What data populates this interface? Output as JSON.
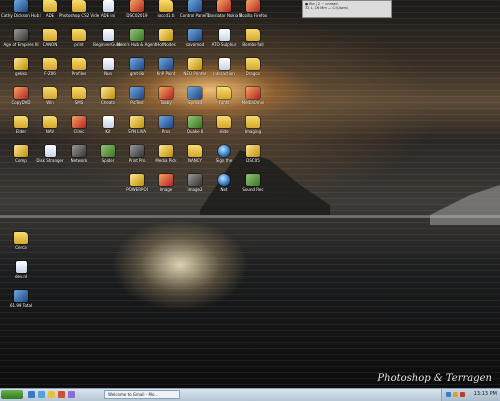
{
  "desktop": {
    "icons": [
      {
        "label": "Cathy Dickson Hub Manager",
        "kind": "app"
      },
      {
        "label": "ADE",
        "kind": "folder"
      },
      {
        "label": "Photoshop CS2 Video",
        "kind": "folder"
      },
      {
        "label": "ADE ini",
        "kind": "doc"
      },
      {
        "label": "DSC02019",
        "kind": "red"
      },
      {
        "label": "ioccd1.ti",
        "kind": "folder"
      },
      {
        "label": "Control Panel 1",
        "kind": "app"
      },
      {
        "label": "Translator Nokia 5",
        "kind": "red"
      },
      {
        "label": "Mozilla Firefox",
        "kind": "red"
      },
      {
        "label": "Age of Empires III",
        "kind": "dark"
      },
      {
        "label": "CANON",
        "kind": "folder"
      },
      {
        "label": "print",
        "kind": "folder"
      },
      {
        "label": "BeginnerGuide",
        "kind": "doc"
      },
      {
        "label": "Nero's Hub & Agent 2",
        "kind": "green"
      },
      {
        "label": "HotNodes",
        "kind": "gold"
      },
      {
        "label": "savamod",
        "kind": "app"
      },
      {
        "label": "ATO Sulphur",
        "kind": "doc"
      },
      {
        "label": "Bombs-fall",
        "kind": "folder"
      },
      {
        "label": "gekko",
        "kind": "gold"
      },
      {
        "label": "F-Z06",
        "kind": "folder"
      },
      {
        "label": "Profiles",
        "kind": "folder"
      },
      {
        "label": "Nun",
        "kind": "doc"
      },
      {
        "label": "gmt-lib",
        "kind": "app"
      },
      {
        "label": "KnP Paint",
        "kind": "app"
      },
      {
        "label": "NEO Printer",
        "kind": "gold"
      },
      {
        "label": "Interaction",
        "kind": "doc"
      },
      {
        "label": "Dragon",
        "kind": "folder"
      },
      {
        "label": "CopyDVD",
        "kind": "red"
      },
      {
        "label": "Win",
        "kind": "folder"
      },
      {
        "label": "SMS",
        "kind": "folder"
      },
      {
        "label": "Cheats",
        "kind": "gold"
      },
      {
        "label": "PicTest",
        "kind": "app"
      },
      {
        "label": "Tabby",
        "kind": "red"
      },
      {
        "label": "Spread",
        "kind": "app"
      },
      {
        "label": "Fonts",
        "kind": "folder"
      },
      {
        "label": "MediaOmni",
        "kind": "red"
      },
      {
        "label": "Elder",
        "kind": "folder"
      },
      {
        "label": "NAV",
        "kind": "folder"
      },
      {
        "label": "Clinic",
        "kind": "red"
      },
      {
        "label": "Kit",
        "kind": "doc"
      },
      {
        "label": "SYN LIVA",
        "kind": "gold"
      },
      {
        "label": "Pros",
        "kind": "app"
      },
      {
        "label": "Quake II",
        "kind": "green"
      },
      {
        "label": "Hide",
        "kind": "folder"
      },
      {
        "label": "Imaging",
        "kind": "folder"
      },
      {
        "label": "Comp",
        "kind": "gold"
      },
      {
        "label": "Disk Stranger",
        "kind": "doc"
      },
      {
        "label": "Network",
        "kind": "dark"
      },
      {
        "label": "Spider",
        "kind": "green"
      },
      {
        "label": "Print Pro",
        "kind": "dark"
      },
      {
        "label": "Media Pick",
        "kind": "gold"
      },
      {
        "label": "NANCY",
        "kind": "folder"
      },
      {
        "label": "Sign the",
        "kind": "globe"
      },
      {
        "label": "DSC05",
        "kind": "gold"
      },
      {
        "label": "POWERPOI",
        "kind": "gold"
      },
      {
        "label": "Image",
        "kind": "red"
      },
      {
        "label": "image2",
        "kind": "dark"
      },
      {
        "label": "Net",
        "kind": "globe"
      },
      {
        "label": "Sound Rec",
        "kind": "green"
      },
      {
        "label": "Cerca",
        "kind": "folder"
      },
      {
        "label": "dev.nl",
        "kind": "doc"
      },
      {
        "label": "61.99 Total",
        "kind": "app"
      }
    ],
    "watermark": "Photoshop & Terragen"
  },
  "top_window": {
    "line1": "● file | 2 ~ unread",
    "line2": "32 L, 16 Mm — C:\\Users\\ "
  },
  "taskbar": {
    "task_label": "Welcome to Gmail - Mo...",
    "clock": "13:13 PM"
  },
  "colors": {
    "taskbar": "#c9d6e3",
    "start": "#2f7d20"
  }
}
